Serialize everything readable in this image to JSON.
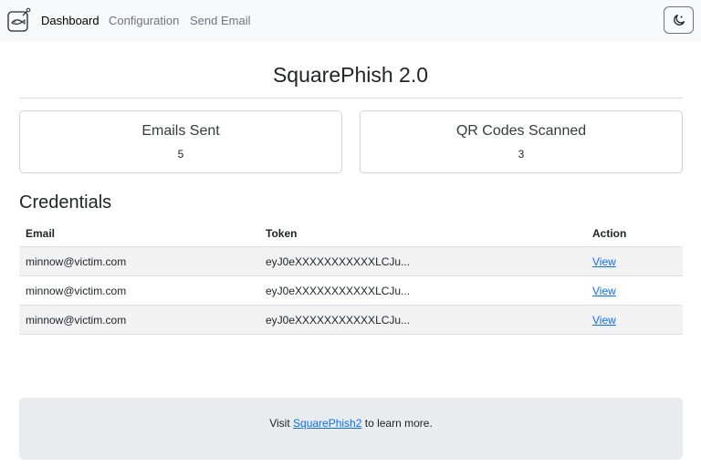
{
  "nav": {
    "items": [
      {
        "label": "Dashboard",
        "active": true
      },
      {
        "label": "Configuration",
        "active": false
      },
      {
        "label": "Send Email",
        "active": false
      }
    ],
    "icons": {
      "logo": "fishbowl-logo-icon",
      "theme_toggle": "moon-stars-icon"
    }
  },
  "header": {
    "title": "SquarePhish 2.0"
  },
  "stats": {
    "emails_sent": {
      "label": "Emails Sent",
      "value": "5"
    },
    "qr_scanned": {
      "label": "QR Codes Scanned",
      "value": "3"
    }
  },
  "credentials": {
    "title": "Credentials",
    "columns": [
      "Email",
      "Token",
      "Action"
    ],
    "rows": [
      {
        "email": "minnow@victim.com",
        "token": "eyJ0eXXXXXXXXXXXLCJu...",
        "action": "View"
      },
      {
        "email": "minnow@victim.com",
        "token": "eyJ0eXXXXXXXXXXXLCJu...",
        "action": "View"
      },
      {
        "email": "minnow@victim.com",
        "token": "eyJ0eXXXXXXXXXXXLCJu...",
        "action": "View"
      }
    ]
  },
  "footer": {
    "prefix": "Visit ",
    "link": "SquarePhish2",
    "suffix": " to learn more."
  },
  "colors": {
    "link": "#0d6efd",
    "navbar_bg": "#f8f9fa",
    "footer_bg": "#e9ecef",
    "stripe": "#f2f2f2"
  }
}
